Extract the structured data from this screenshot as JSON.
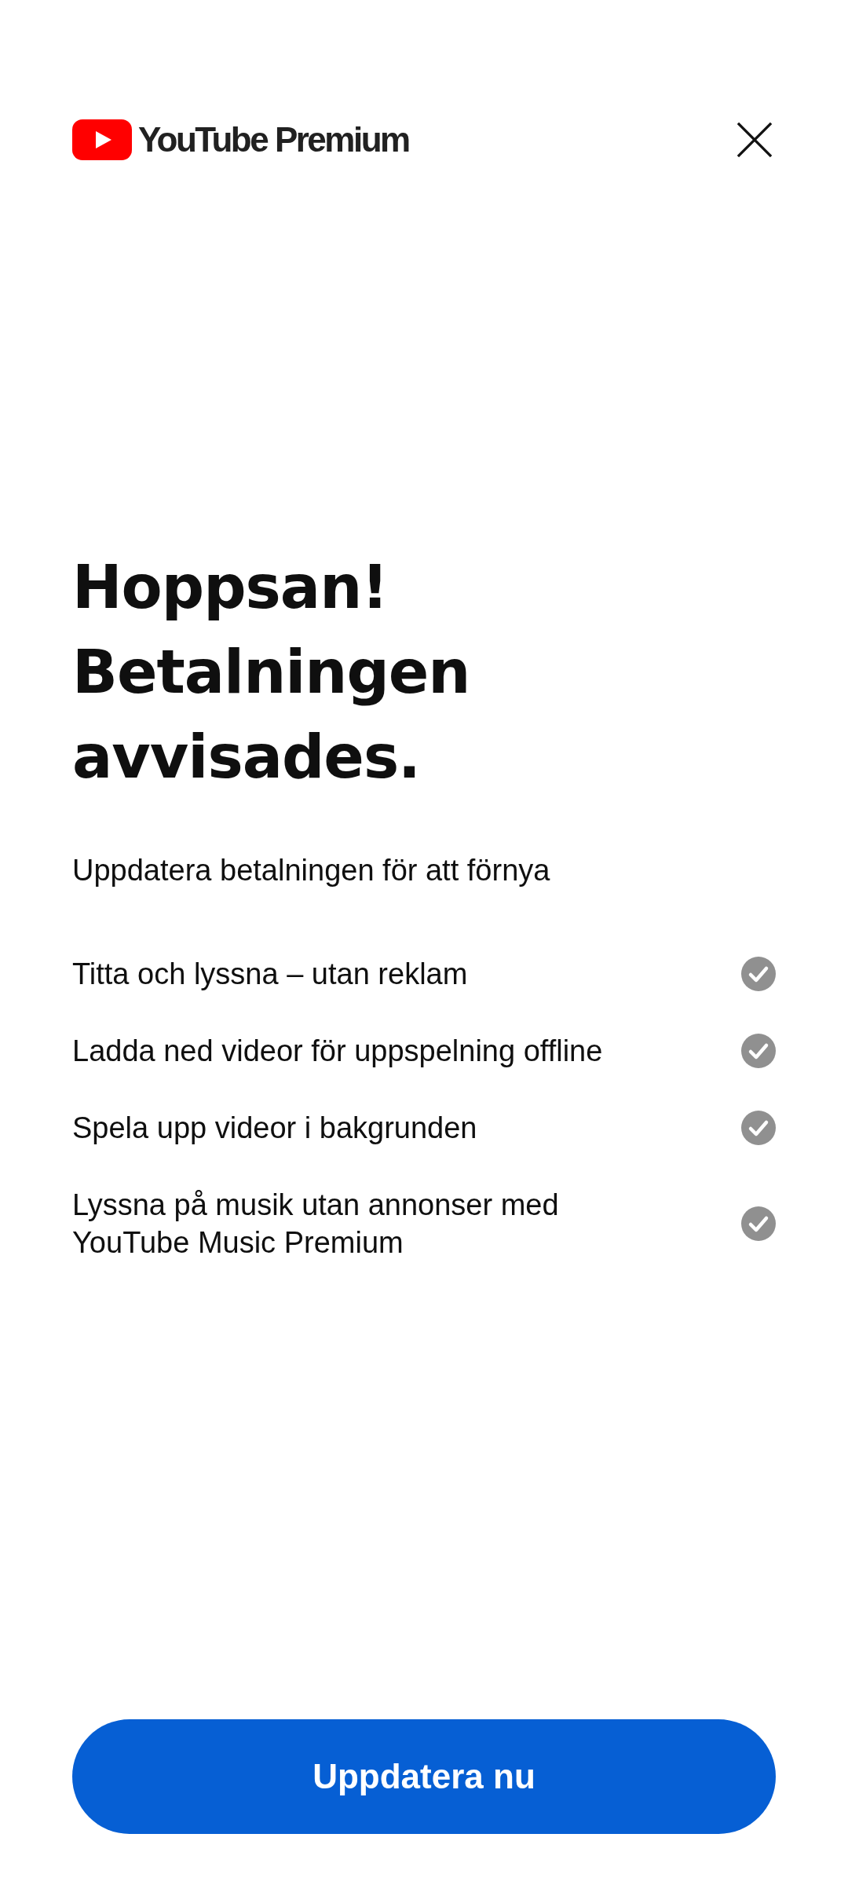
{
  "header": {
    "brand": "YouTube Premium"
  },
  "title": "Hoppsan! Betalningen avvisades.",
  "subtitle": "Uppdatera betalningen för att förnya",
  "features": [
    {
      "text": "Titta och lyssna – utan reklam"
    },
    {
      "text": "Ladda ned videor för uppspelning offline"
    },
    {
      "text": "Spela upp videor i bakgrunden"
    },
    {
      "text": "Lyssna på musik utan annonser med YouTube Music Premium"
    }
  ],
  "button": "Uppdatera nu"
}
